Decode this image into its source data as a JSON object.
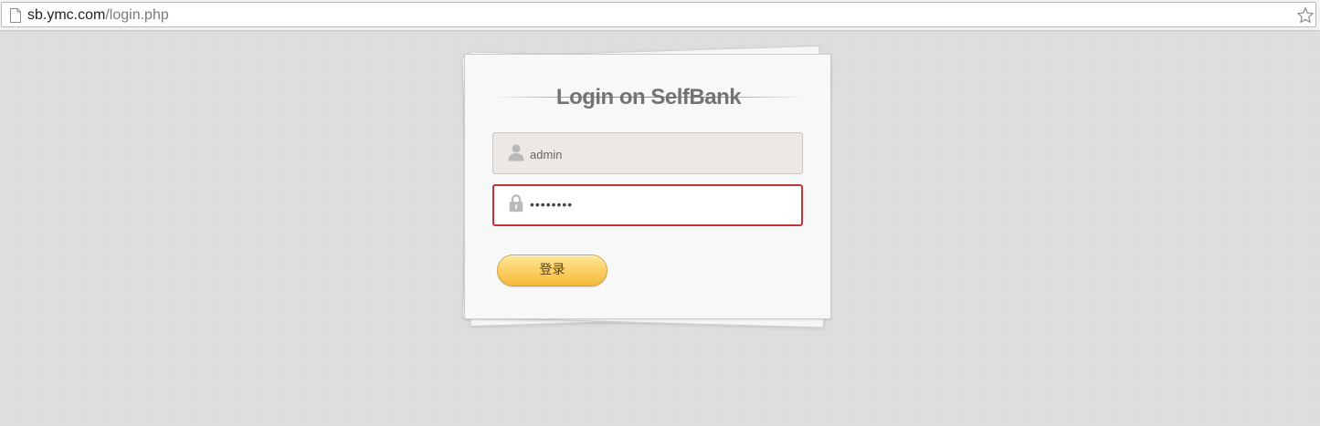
{
  "browser": {
    "url_host": "sb.ymc.com",
    "url_path": "/login.php",
    "page_icon": "page-icon",
    "star_icon": "star-icon"
  },
  "login": {
    "title": "Login on SelfBank",
    "username_value": "admin",
    "password_value": "••••••••",
    "submit_label": "登录",
    "username_icon": "user-icon",
    "password_icon": "lock-icon"
  },
  "colors": {
    "page_background": "#dedede",
    "error_border": "#c3333a",
    "button_gradient_top": "#fde89a",
    "button_gradient_bottom": "#f6b93a"
  }
}
